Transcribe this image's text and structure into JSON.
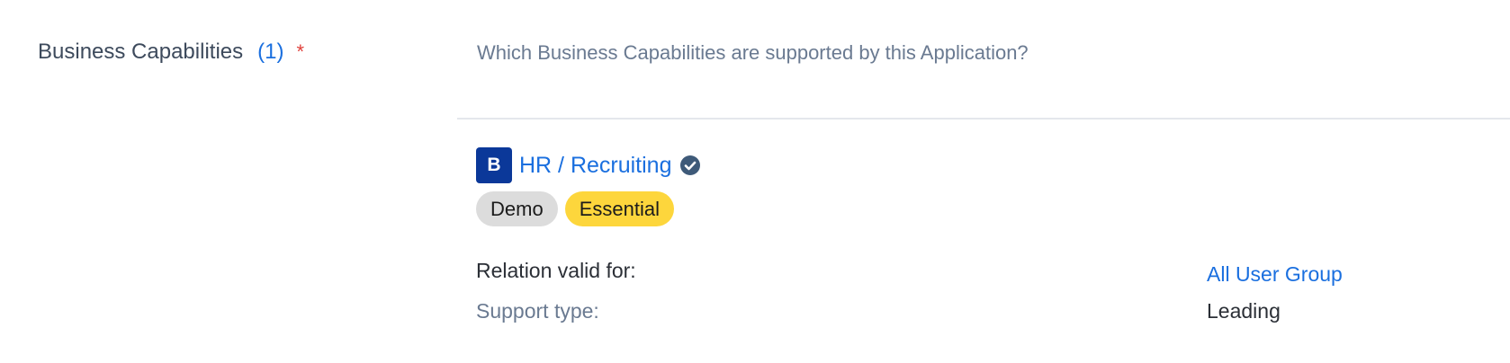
{
  "field": {
    "label": "Business Capabilities",
    "count": "(1)",
    "required_mark": "*",
    "question": "Which Business Capabilities are supported by this Application?"
  },
  "relation": {
    "type_badge": "B",
    "name": "HR / Recruiting",
    "verified_icon": "check-circle-icon",
    "tags": [
      {
        "label": "Demo",
        "color": "#dcdcdc"
      },
      {
        "label": "Essential",
        "color": "#fdd63c"
      }
    ],
    "attributes": [
      {
        "label": "Relation valid for:",
        "value": "All User Group"
      },
      {
        "label": "Support type:",
        "value": "Leading"
      }
    ]
  },
  "colors": {
    "accent": "#1a6fdf",
    "badge_bg": "#0b3899",
    "required": "#e0413b"
  }
}
